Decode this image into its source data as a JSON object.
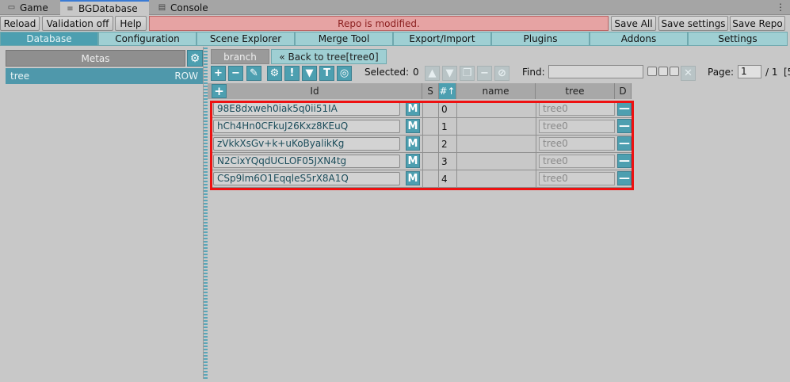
{
  "window_tabs": [
    {
      "label": "Game",
      "icon": "gamepad-icon"
    },
    {
      "label": "BGDatabase",
      "icon": "database-icon"
    },
    {
      "label": "Console",
      "icon": "console-icon"
    }
  ],
  "toolbar": {
    "reload": "Reload",
    "validation": "Validation off",
    "help": "Help",
    "banner": "Repo is modified.",
    "save_all": "Save All",
    "save_settings": "Save settings",
    "save_repo": "Save Repo"
  },
  "nav_tabs": [
    "Database",
    "Configuration",
    "Scene Explorer",
    "Merge Tool",
    "Export/Import",
    "Plugins",
    "Addons",
    "Settings"
  ],
  "left": {
    "metas_label": "Metas",
    "meta_items": [
      {
        "name": "tree",
        "kind": "ROW"
      }
    ]
  },
  "right": {
    "branch_tab": "branch",
    "back_link": "« Back to tree[tree0]",
    "selected_label": "Selected:",
    "selected_count": "0",
    "find_label": "Find:",
    "page_label": "Page:",
    "page_value": "1",
    "page_total": "/ 1",
    "page_cut": "[5"
  },
  "table": {
    "columns": {
      "id": "Id",
      "s": "S",
      "num": "#↑",
      "name": "name",
      "tree": "tree",
      "d": "D"
    },
    "rows": [
      {
        "id": "98E8dxweh0iak5q0ii51IA",
        "num": "0",
        "tree": "tree0"
      },
      {
        "id": "hCh4Hn0CFkuJ26Kxz8KEuQ",
        "num": "1",
        "tree": "tree0"
      },
      {
        "id": "zVkkXsGv+k+uKoByalikKg",
        "num": "2",
        "tree": "tree0"
      },
      {
        "id": "N2CixYQqdUCLOF05JXN4tg",
        "num": "3",
        "tree": "tree0"
      },
      {
        "id": "CSp9lm6O1EqqleS5rX8A1Q",
        "num": "4",
        "tree": "tree0"
      }
    ],
    "m_label": "M",
    "d_label": "—"
  },
  "colors": {
    "accent": "#4d9fb0",
    "tab": "#9fcfd3",
    "banner": "#e6a3a3",
    "highlight": "#ee1111"
  }
}
